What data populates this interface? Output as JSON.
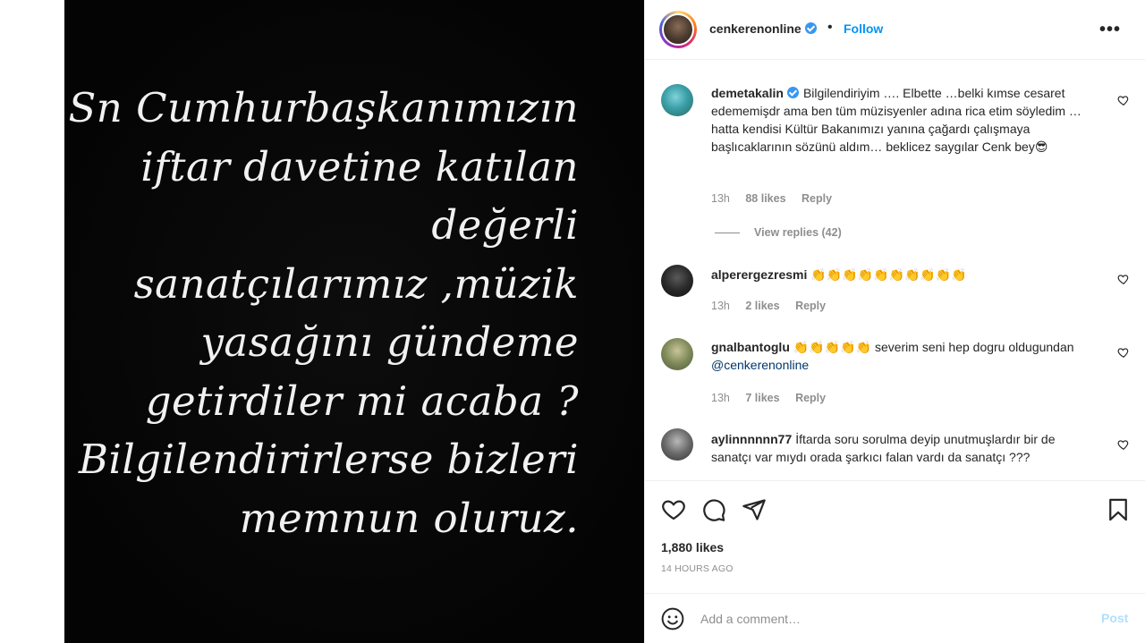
{
  "media": {
    "lines": [
      "Sn Cumhurbaşkanımızın",
      "iftar davetine katılan",
      "değerli",
      "sanatçılarımız ,müzik",
      "yasağını gündeme",
      "getirdiler mi acaba ?",
      "Bilgilendirirlerse bizleri",
      "memnun oluruz."
    ]
  },
  "header": {
    "username": "cenkerenonline",
    "dot": "•",
    "follow_label": "Follow",
    "more_label": "•••"
  },
  "comments": [
    {
      "user": "demetakalin",
      "verified": true,
      "text": "Bilgilendiriyim …. Elbette …belki kımse cesaret edememişdr ama ben tüm müzisyenler adına rica etim söyledim …hatta kendisi Kültür Bakanımızı yanına çağardı çalışmaya başlıcaklarının sözünü aldım… beklicez saygılar Cenk bey😎",
      "time": "13h",
      "likes": "88 likes",
      "reply": "Reply",
      "view_replies": "View replies (42)"
    },
    {
      "user": "alperergezresmi",
      "text": "👏👏👏👏👏👏👏👏👏👏",
      "time": "13h",
      "likes": "2 likes",
      "reply": "Reply"
    },
    {
      "user": "gnalbantoglu",
      "text": "👏👏👏👏👏 severim seni hep dogru oldugundan ",
      "mention": "@cenkerenonline",
      "time": "13h",
      "likes": "7 likes",
      "reply": "Reply"
    },
    {
      "user": "aylinnnnnn77",
      "text": "İftarda soru sorulma deyip unutmuşlardır bir de sanatçı var mıydı orada şarkıcı falan vardı da sanatçı ???"
    }
  ],
  "actions": {
    "likes": "1,880 likes",
    "time_ago": "14 HOURS AGO"
  },
  "add_comment": {
    "placeholder": "Add a comment…",
    "post_label": "Post"
  },
  "colors": {
    "link": "#0095f6",
    "verified": "#3897f0",
    "muted": "#8e8e8e",
    "post_disabled": "#b2dffc"
  },
  "icons": [
    "heart-icon",
    "comment-icon",
    "share-icon",
    "bookmark-icon",
    "emoji-icon",
    "more-icon",
    "verified-badge-icon"
  ]
}
